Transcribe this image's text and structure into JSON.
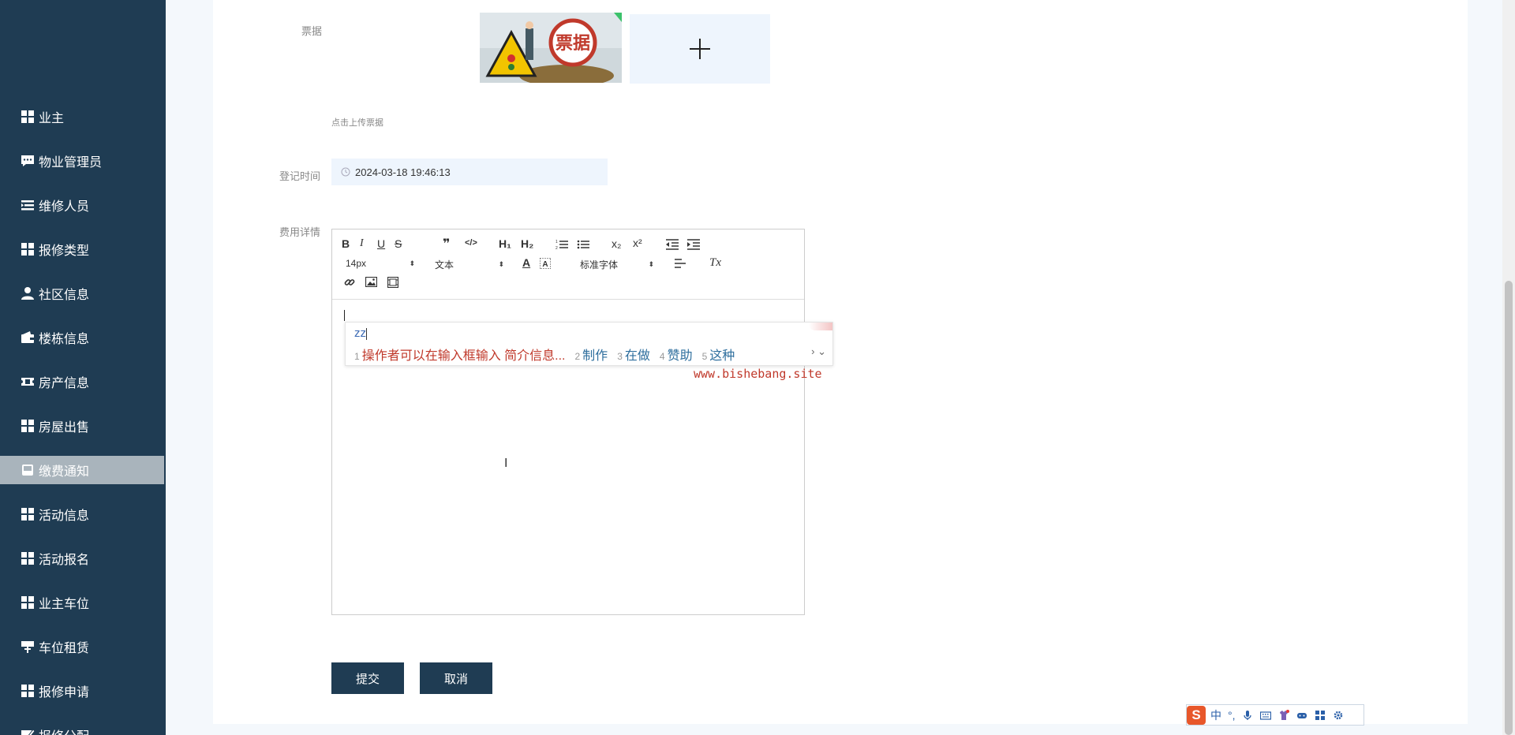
{
  "sidebar": {
    "items": [
      {
        "label": "业主",
        "icon": "grid-icon"
      },
      {
        "label": "物业管理员",
        "icon": "chat-icon"
      },
      {
        "label": "维修人员",
        "icon": "list-icon"
      },
      {
        "label": "报修类型",
        "icon": "grid-icon"
      },
      {
        "label": "社区信息",
        "icon": "user-icon"
      },
      {
        "label": "楼栋信息",
        "icon": "wallet-icon"
      },
      {
        "label": "房产信息",
        "icon": "ticket-icon"
      },
      {
        "label": "房屋出售",
        "icon": "grid-icon"
      },
      {
        "label": "缴费通知",
        "icon": "inbox-icon",
        "active": true
      },
      {
        "label": "活动信息",
        "icon": "grid-icon"
      },
      {
        "label": "活动报名",
        "icon": "grid-icon"
      },
      {
        "label": "业主车位",
        "icon": "grid-icon"
      },
      {
        "label": "车位租赁",
        "icon": "sign-icon"
      },
      {
        "label": "报修申请",
        "icon": "grid-icon"
      },
      {
        "label": "报修分配",
        "icon": "edit-icon"
      }
    ]
  },
  "form": {
    "receipt_label": "票据",
    "receipt_image_text": "票据",
    "upload_hint": "点击上传票据",
    "time_label": "登记时间",
    "time_value": "2024-03-18 19:46:13",
    "detail_label": "费用详情",
    "submit_label": "提交",
    "cancel_label": "取消"
  },
  "editor": {
    "toolbar": {
      "bold": "B",
      "italic": "I",
      "underline": "U",
      "strike": "S",
      "quote": "❞",
      "code": "</>",
      "h1": "H₁",
      "h2": "H₂",
      "subscript": "x₂",
      "superscript": "x²",
      "text_color": "A",
      "clear_format": "Tx",
      "font_size": "14px",
      "heading": "文本",
      "font_family": "标准字体"
    }
  },
  "ime": {
    "input": "zz",
    "candidates": [
      {
        "num": "1",
        "text": "操作者可以在输入框输入 简介信息..."
      },
      {
        "num": "2",
        "text": "制作"
      },
      {
        "num": "3",
        "text": "在做"
      },
      {
        "num": "4",
        "text": "赞助"
      },
      {
        "num": "5",
        "text": "这种"
      }
    ],
    "nav": "› ⌄",
    "status_lang": "中",
    "status_punct": "°,"
  },
  "watermark": "www.bishebang.site",
  "colors": {
    "sidebar_bg": "#1f3c53",
    "active_item_bg": "#a9b4bc",
    "button_bg": "#1f3c53",
    "field_bg": "#eef5fd",
    "ime_highlight": "#c0392b"
  }
}
